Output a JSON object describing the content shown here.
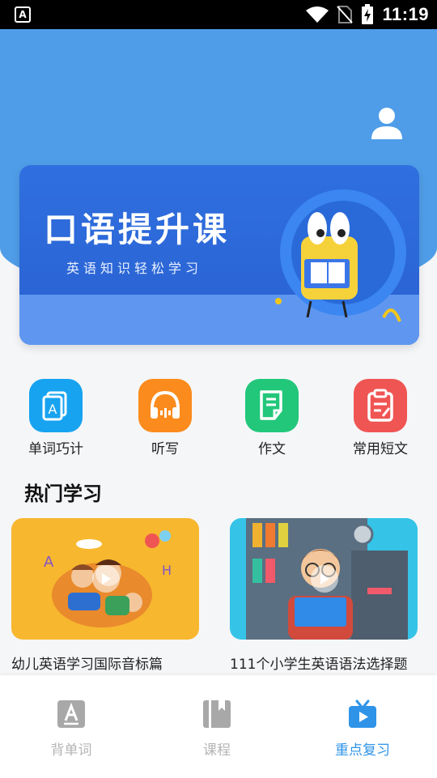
{
  "status_bar": {
    "left_icon": "A",
    "time": "11:19",
    "icons": [
      "wifi-icon",
      "no-sim-icon",
      "battery-charging-icon"
    ]
  },
  "header": {
    "profile_icon": "person-icon"
  },
  "banner": {
    "title": "口语提升课",
    "subtitle": "英语知识轻松学习"
  },
  "quick_actions": [
    {
      "label": "单词巧计",
      "icon": "word-card-icon",
      "color": "#17a3f0"
    },
    {
      "label": "听写",
      "icon": "headphones-icon",
      "color": "#fb8b1c"
    },
    {
      "label": "作文",
      "icon": "document-icon",
      "color": "#22c77a"
    },
    {
      "label": "常用短文",
      "icon": "clipboard-icon",
      "color": "#ef5553"
    }
  ],
  "section": {
    "title": "热门学习"
  },
  "cards": [
    {
      "title": "幼儿英语学习国际音标篇"
    },
    {
      "title": "111个小学生英语语法选择题"
    }
  ],
  "bottom_nav": {
    "items": [
      {
        "label": "背单词",
        "icon": "letter-a-icon",
        "active": false
      },
      {
        "label": "课程",
        "icon": "book-icon",
        "active": false
      },
      {
        "label": "重点复习",
        "icon": "tv-play-icon",
        "active": true
      }
    ],
    "active_color": "#2f94e8",
    "inactive_color": "#b4b4b4"
  }
}
